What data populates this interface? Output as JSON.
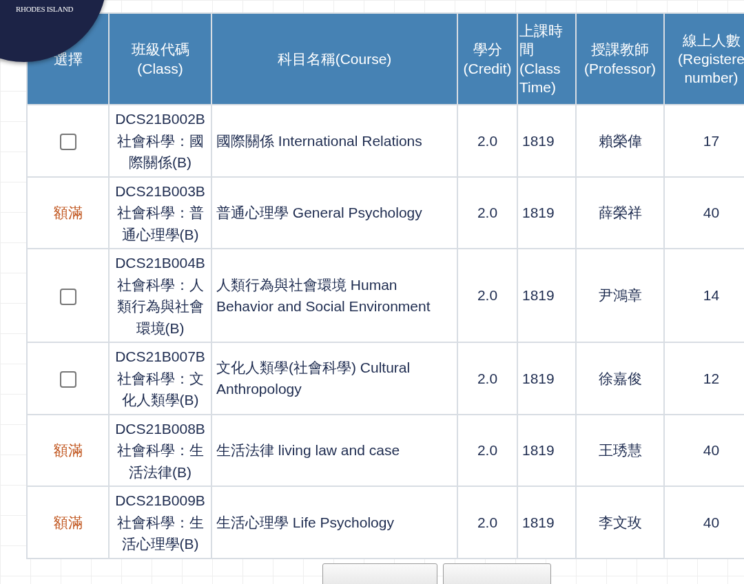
{
  "badge": {
    "text": "RHODES ISLAND"
  },
  "table": {
    "columns": [
      {
        "label": "選擇"
      },
      {
        "label": "班級代碼\n(Class)"
      },
      {
        "label": "科目名稱(Course)"
      },
      {
        "label": "學分\n(Credit)"
      },
      {
        "label": "上課時間(Class Time)"
      },
      {
        "label": "授課教師\n(Professor)"
      },
      {
        "label": "線上人數\n(Registere\nnumber)"
      }
    ],
    "rows": [
      {
        "select": {
          "kind": "checkbox",
          "checked": false
        },
        "code": "DCS21B002B",
        "class_name": "社會科學：國際關係(B)",
        "course": "國際關係 International Relations",
        "credit": "2.0",
        "time": "1819",
        "professor": "賴榮偉",
        "registered": "17"
      },
      {
        "select": {
          "kind": "full",
          "label": "額滿"
        },
        "code": "DCS21B003B",
        "class_name": "社會科學：普通心理學(B)",
        "course": "普通心理學 General Psychology",
        "credit": "2.0",
        "time": "1819",
        "professor": "薛榮祥",
        "registered": "40"
      },
      {
        "select": {
          "kind": "checkbox",
          "checked": false
        },
        "code": "DCS21B004B",
        "class_name": "社會科學：人類行為與社會環境(B)",
        "course": "人類行為與社會環境 Human Behavior and Social Environment",
        "credit": "2.0",
        "time": "1819",
        "professor": "尹鴻章",
        "registered": "14"
      },
      {
        "select": {
          "kind": "checkbox",
          "checked": false
        },
        "code": "DCS21B007B",
        "class_name": "社會科學：文化人類學(B)",
        "course": "文化人類學(社會科學) Cultural Anthropology",
        "credit": "2.0",
        "time": "1819",
        "professor": "徐嘉俊",
        "registered": "12"
      },
      {
        "select": {
          "kind": "full",
          "label": "額滿"
        },
        "code": "DCS21B008B",
        "class_name": "社會科學：生活法律(B)",
        "course": "生活法律 living law and case",
        "credit": "2.0",
        "time": "1819",
        "professor": "王琇慧",
        "registered": "40"
      },
      {
        "select": {
          "kind": "full",
          "label": "額滿"
        },
        "code": "DCS21B009B",
        "class_name": "社會科學：生活心理學(B)",
        "course": "生活心理學 Life Psychology",
        "credit": "2.0",
        "time": "1819",
        "professor": "李文玫",
        "registered": "40"
      }
    ]
  },
  "buttons": [
    {
      "kind": "push"
    },
    {
      "kind": "push"
    }
  ]
}
